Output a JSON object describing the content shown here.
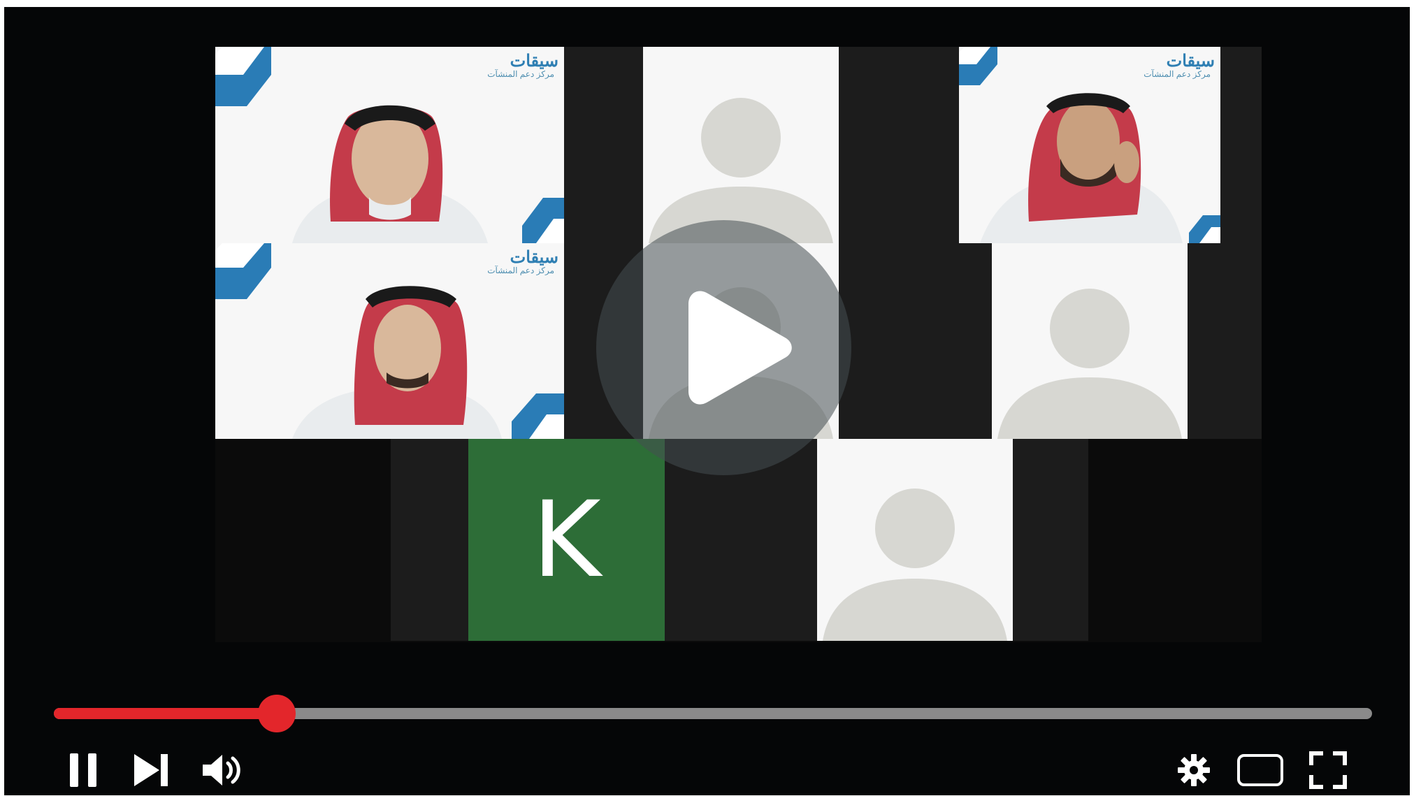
{
  "player": {
    "background_color": "#050607",
    "accent_color": "#e3262b",
    "progress_fraction": 0.169,
    "overlay_icon": "play-icon"
  },
  "participants": [
    {
      "id": "speaker-top-left",
      "type": "video",
      "brand_text": "سيقات",
      "brand_sub": "مركز دعم المنشآت"
    },
    {
      "id": "placeholder-top-middle",
      "type": "placeholder"
    },
    {
      "id": "speaker-top-right",
      "type": "video",
      "brand_text": "سيقات",
      "brand_sub": "مركز دعم المنشآت"
    },
    {
      "id": "speaker-bottom-left",
      "type": "video",
      "brand_text": "سيقات",
      "brand_sub": "مركز دعم المنشآت"
    },
    {
      "id": "placeholder-middle-center",
      "type": "placeholder"
    },
    {
      "id": "placeholder-middle-right",
      "type": "placeholder"
    },
    {
      "id": "initial-k",
      "type": "initial",
      "initial": "K",
      "color": "#2d6d37"
    },
    {
      "id": "placeholder-bottom-center",
      "type": "placeholder"
    }
  ],
  "controls": {
    "pause_icon": "pause-icon",
    "next_icon": "next-icon",
    "volume_icon": "volume-icon",
    "settings_icon": "settings-gear-icon",
    "theater_icon": "theater-mode-icon",
    "fullscreen_icon": "fullscreen-icon"
  }
}
